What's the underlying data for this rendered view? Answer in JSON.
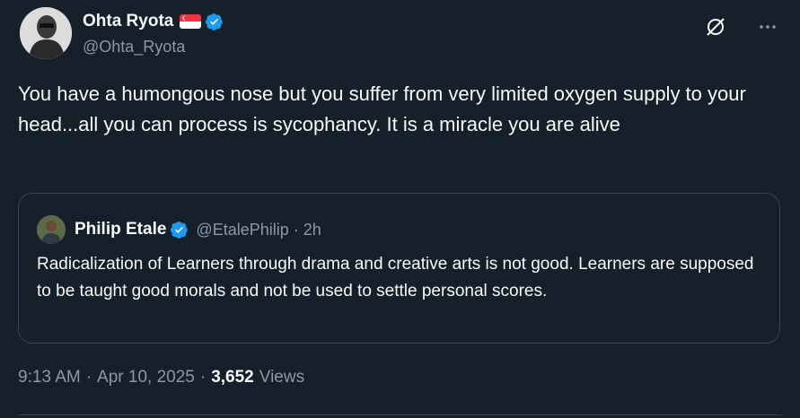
{
  "author": {
    "display_name": "Ohta Ryota",
    "handle": "@Ohta_Ryota",
    "flag": "singapore-flag",
    "verified": true
  },
  "icons": {
    "grok": "grok-icon",
    "more": "more-icon",
    "verified": "verified-badge-icon"
  },
  "tweet": {
    "text": "You have a humongous nose but you suffer from very limited oxygen supply to your head...all you can process is sycophancy. It is a miracle you are alive"
  },
  "quote": {
    "display_name": "Philip Etale",
    "handle": "@EtalePhilip",
    "separator": "·",
    "time": "2h",
    "text": "Radicalization of Learners through drama and creative arts is not good. Learners are supposed to be taught good morals and not be used to settle personal scores."
  },
  "meta": {
    "time": "9:13 AM",
    "sep1": "·",
    "date": "Apr 10, 2025",
    "sep2": "·",
    "views_count": "3,652",
    "views_label": "Views"
  },
  "colors": {
    "background": "#15202b",
    "text": "#f7f9f9",
    "secondary": "#8b98a5",
    "border": "#38444d",
    "verified": "#1d9bf0"
  }
}
